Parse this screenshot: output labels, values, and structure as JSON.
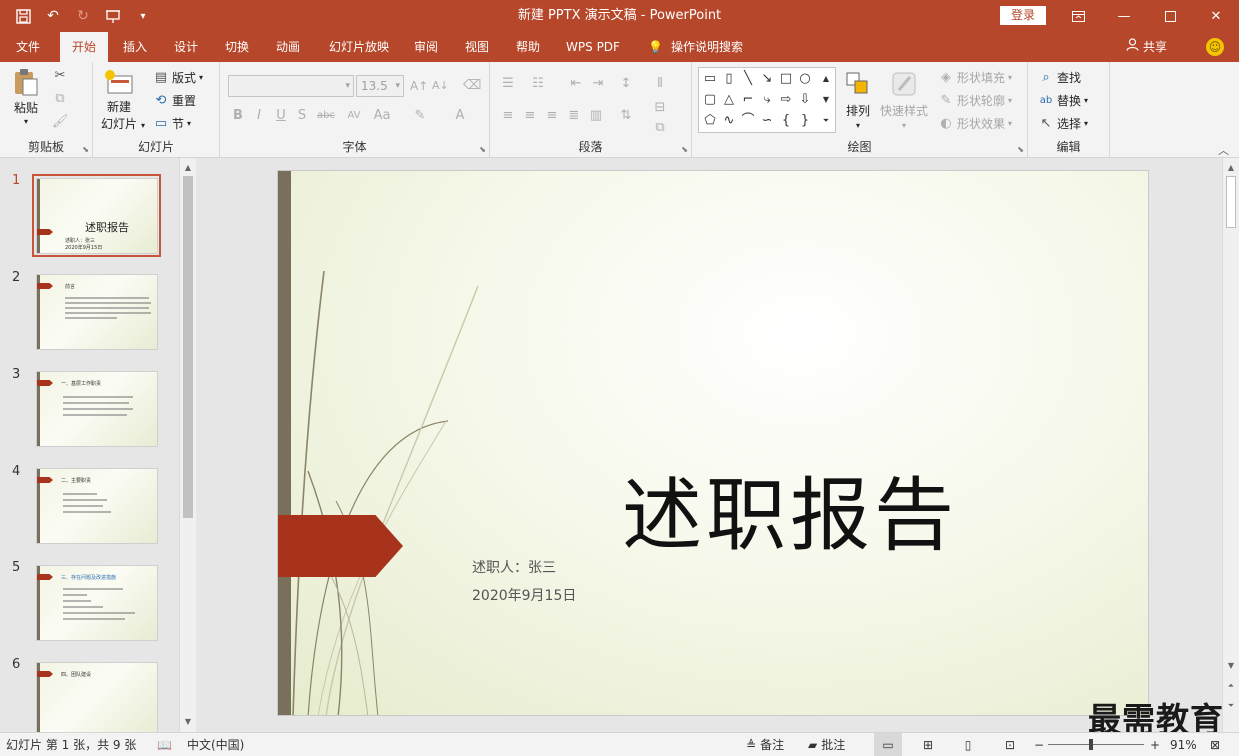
{
  "app": {
    "window_title": "新建 PPTX 演示文稿 - PowerPoint",
    "signin_label": "登录",
    "share_label": "共享",
    "tell_me": "操作说明搜索"
  },
  "qat": [
    "save-icon",
    "undo-icon",
    "redo-icon",
    "present-icon",
    "customize-icon"
  ],
  "tabs": [
    {
      "label": "文件"
    },
    {
      "label": "开始"
    },
    {
      "label": "插入"
    },
    {
      "label": "设计"
    },
    {
      "label": "切换"
    },
    {
      "label": "动画"
    },
    {
      "label": "幻灯片放映"
    },
    {
      "label": "审阅"
    },
    {
      "label": "视图"
    },
    {
      "label": "帮助"
    },
    {
      "label": "WPS PDF"
    }
  ],
  "active_tab": "开始",
  "ribbon": {
    "clipboard": {
      "label": "剪贴板",
      "paste": "粘贴"
    },
    "slides": {
      "label": "幻灯片",
      "new_slide_1": "新建",
      "new_slide_2": "幻灯片",
      "layout": "版式",
      "reset": "重置",
      "section": "节"
    },
    "font": {
      "label": "字体",
      "font_size": "13.5",
      "bold": "B",
      "italic": "I",
      "underline": "U",
      "shadow": "S",
      "strike": "abc",
      "spacing": "AV",
      "case": "Aa",
      "color": "A"
    },
    "paragraph": {
      "label": "段落"
    },
    "drawing": {
      "label": "绘图",
      "arrange": "排列",
      "quick_styles": "快速样式",
      "shape_fill": "形状填充",
      "shape_outline": "形状轮廓",
      "shape_effects": "形状效果"
    },
    "editing": {
      "label": "编辑",
      "find": "查找",
      "replace": "替换",
      "select": "选择"
    }
  },
  "thumbnails": [
    {
      "num": "1",
      "title": "述职报告",
      "sub1": "述职人：张三",
      "sub2": "2020年9月15日"
    },
    {
      "num": "2",
      "title": "前言"
    },
    {
      "num": "3",
      "title": "一、基层工作职责"
    },
    {
      "num": "4",
      "title": "二、主要职责"
    },
    {
      "num": "5",
      "title": "三、存在问题及改进措施"
    },
    {
      "num": "6",
      "title": "四、团队建设"
    }
  ],
  "slide": {
    "title": "述职报告",
    "presenter": "述职人：张三",
    "date": "2020年9月15日"
  },
  "watermark": "最需教育",
  "status": {
    "slide_info": "幻灯片 第 1 张，共 9 张",
    "language": "中文(中国)",
    "notes": "备注",
    "comments": "批注",
    "zoom": "91%",
    "zoom_level": 0.91
  },
  "colors": {
    "accent": "#b7472a",
    "slide_flag": "#a8331c",
    "slide_bar": "#78705a"
  }
}
